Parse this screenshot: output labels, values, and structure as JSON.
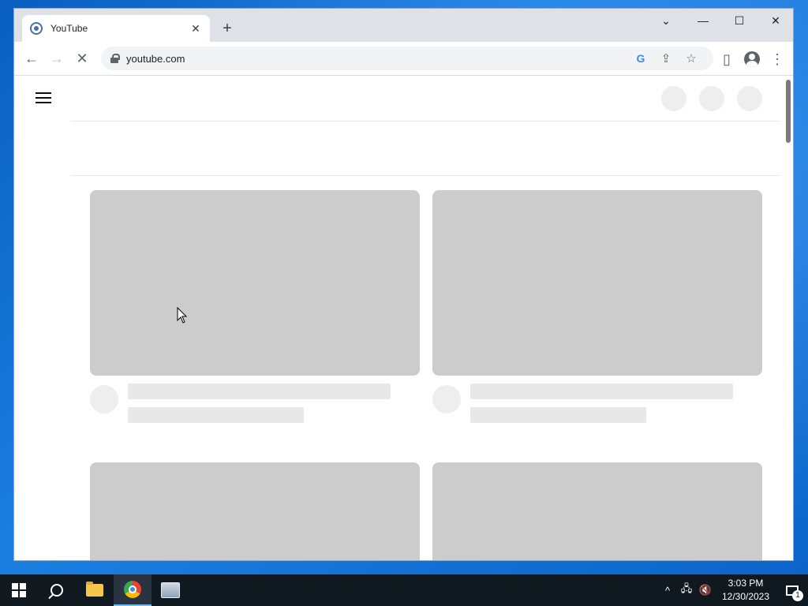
{
  "browser": {
    "tab": {
      "title": "YouTube",
      "favicon": "loading-spinner-icon"
    },
    "new_tab_label": "+",
    "window_controls": {
      "tab_search": "⌄",
      "minimize": "—",
      "maximize": "☐",
      "close": "✕"
    },
    "toolbar": {
      "back": "←",
      "forward": "→",
      "reload": "✕",
      "url": "youtube.com",
      "google_icon": "G",
      "share": "⇪",
      "bookmark": "☆",
      "side_panel": "▯",
      "menu": "⋮"
    }
  },
  "page": {
    "state": "loading-skeleton",
    "colors": {
      "thumbnail": "#cccccc",
      "placeholder": "#e8e8e8"
    }
  },
  "taskbar": {
    "clock_time": "3:03 PM",
    "clock_date": "12/30/2023",
    "tray": {
      "chevron": "^",
      "network": "🖧",
      "volume": "🔇"
    },
    "notification_count": "1"
  }
}
